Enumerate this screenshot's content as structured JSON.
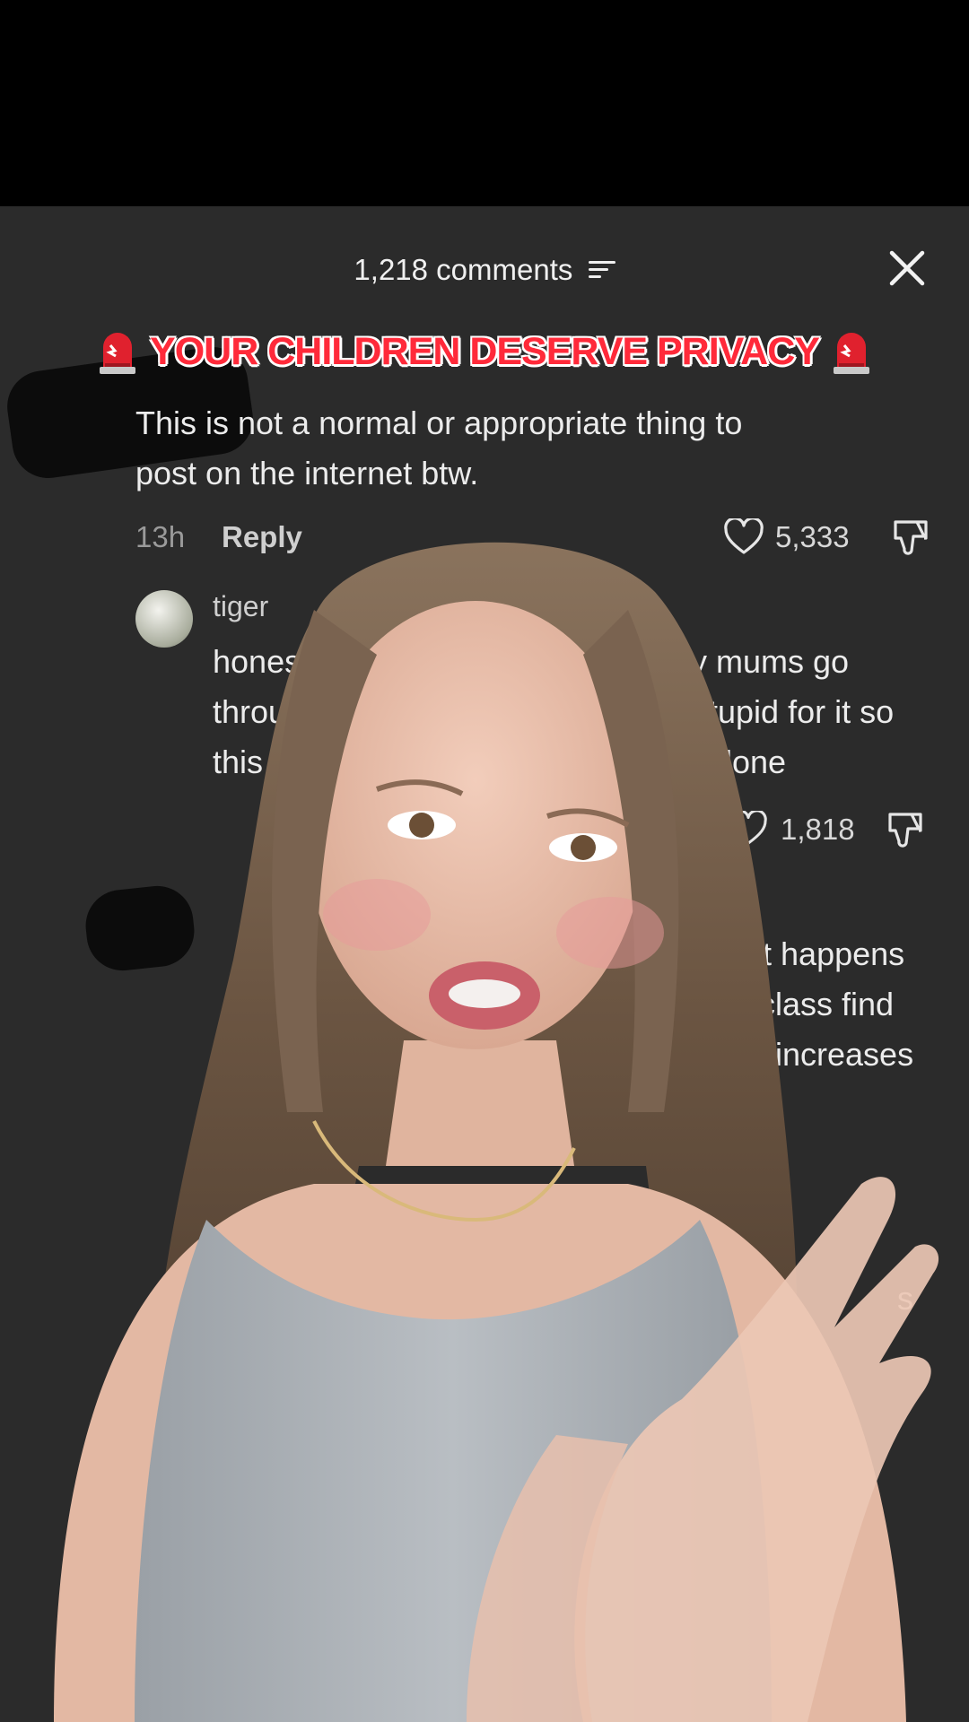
{
  "header": {
    "comments_count": "1,218 comments"
  },
  "banner": {
    "text": "YOUR CHILDREN DESERVE PRIVACY",
    "emoji_icon": "police-siren-icon"
  },
  "comments": [
    {
      "text_line1": "This is not a normal or appropriate thing to",
      "text_line2": "post on the internet btw.",
      "time": "13h",
      "reply_label": "Reply",
      "likes": "5,333"
    },
    {
      "username": "tiger",
      "line1_left": "honest",
      "line1_right": "oy mums go",
      "line2_left": "throu",
      "line2_right": "tupid for it so",
      "line3_left": "this",
      "line3_right": "lone",
      "likes": "1,818"
    },
    {
      "line1_right": "at happens",
      "line2_right": "class find",
      "line3_right": "increases",
      "fragment_right": "s"
    }
  ],
  "colors": {
    "sheet_bg": "#2b2b2b",
    "banner_red": "#ff2a3a",
    "text": "#ececec",
    "meta": "#9a9a9a"
  }
}
